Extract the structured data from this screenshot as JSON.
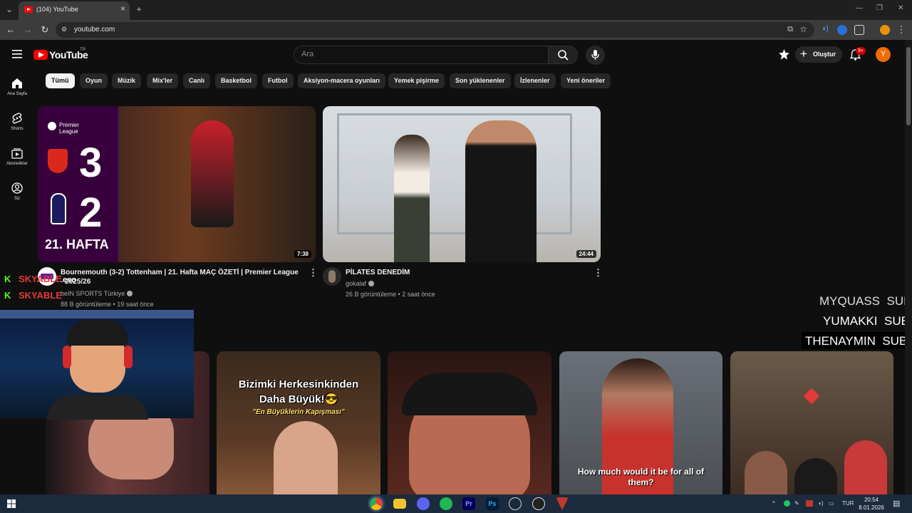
{
  "browser": {
    "tab_title": "(104) YouTube",
    "url": "youtube.com"
  },
  "header": {
    "logo_text": "YouTube",
    "country_code": "TR",
    "search_placeholder": "Ara",
    "create_label": "Oluştur",
    "notification_count": "9+",
    "avatar_letter": "Y"
  },
  "sidebar": {
    "items": [
      {
        "label": "Ana Sayfa",
        "icon": "home-icon"
      },
      {
        "label": "Shorts",
        "icon": "shorts-icon"
      },
      {
        "label": "Abonelikler",
        "icon": "subscriptions-icon"
      },
      {
        "label": "Siz",
        "icon": "you-icon"
      }
    ]
  },
  "chips": [
    "Tümü",
    "Oyun",
    "Müzik",
    "Mix'ler",
    "Canlı",
    "Basketbol",
    "Futbol",
    "Aksiyon-macera oyunları",
    "Yemek pişirme",
    "Son yüklenenler",
    "İzlenenler",
    "Yeni öneriler"
  ],
  "videos": [
    {
      "title": "Bournemouth (3-2) Tottenham | 21. Hafta MAÇ ÖZETİ | Premier League - 2025/26",
      "title_line1": "Bournemouth (3-2) Tottenham | 21. Hafta MAÇ ÖZETİ | Premier League",
      "title_line2": "- 2025/26",
      "channel": "beIN SPORTS Türkiye",
      "stats": "88 B görüntüleme • 19 saat önce",
      "duration": "7:38",
      "thumb_text": {
        "league_line1": "Premier",
        "league_line2": "League",
        "score_home": "3",
        "score_away": "2",
        "week": "21. HAFTA"
      }
    },
    {
      "title": "PİLATES DENEDİM",
      "channel": "gokalaf",
      "stats": "26 B görüntüleme • 2 saat önce",
      "duration": "24:44"
    }
  ],
  "shorts": [
    {
      "overlay_line1": "Bizimki Herkesinkinden",
      "overlay_line2": "Daha Büyük!😎",
      "overlay_line3": "\"En Büyüklerin Kapışması\""
    },
    {},
    {
      "caption": "How much would it be for all of them?"
    },
    {}
  ],
  "stream_overlay": {
    "kick_lines": [
      "SKYABLE",
      "SKYABLE"
    ],
    "kick_partial": "eso",
    "sub_alerts": [
      {
        "name": "MYQUASS",
        "tag": "SUB"
      },
      {
        "name": "YUMAKKI",
        "tag": "SUB"
      },
      {
        "name": "THENAYMIN",
        "tag": "SUB"
      }
    ]
  },
  "taskbar": {
    "language": "TUR",
    "time": "20:54",
    "date": "8.01.2026"
  },
  "colors": {
    "brand_red": "#ff0000",
    "kick_green": "#53fc18",
    "background": "#0f0f0f",
    "avatar": "#ef6c00"
  }
}
